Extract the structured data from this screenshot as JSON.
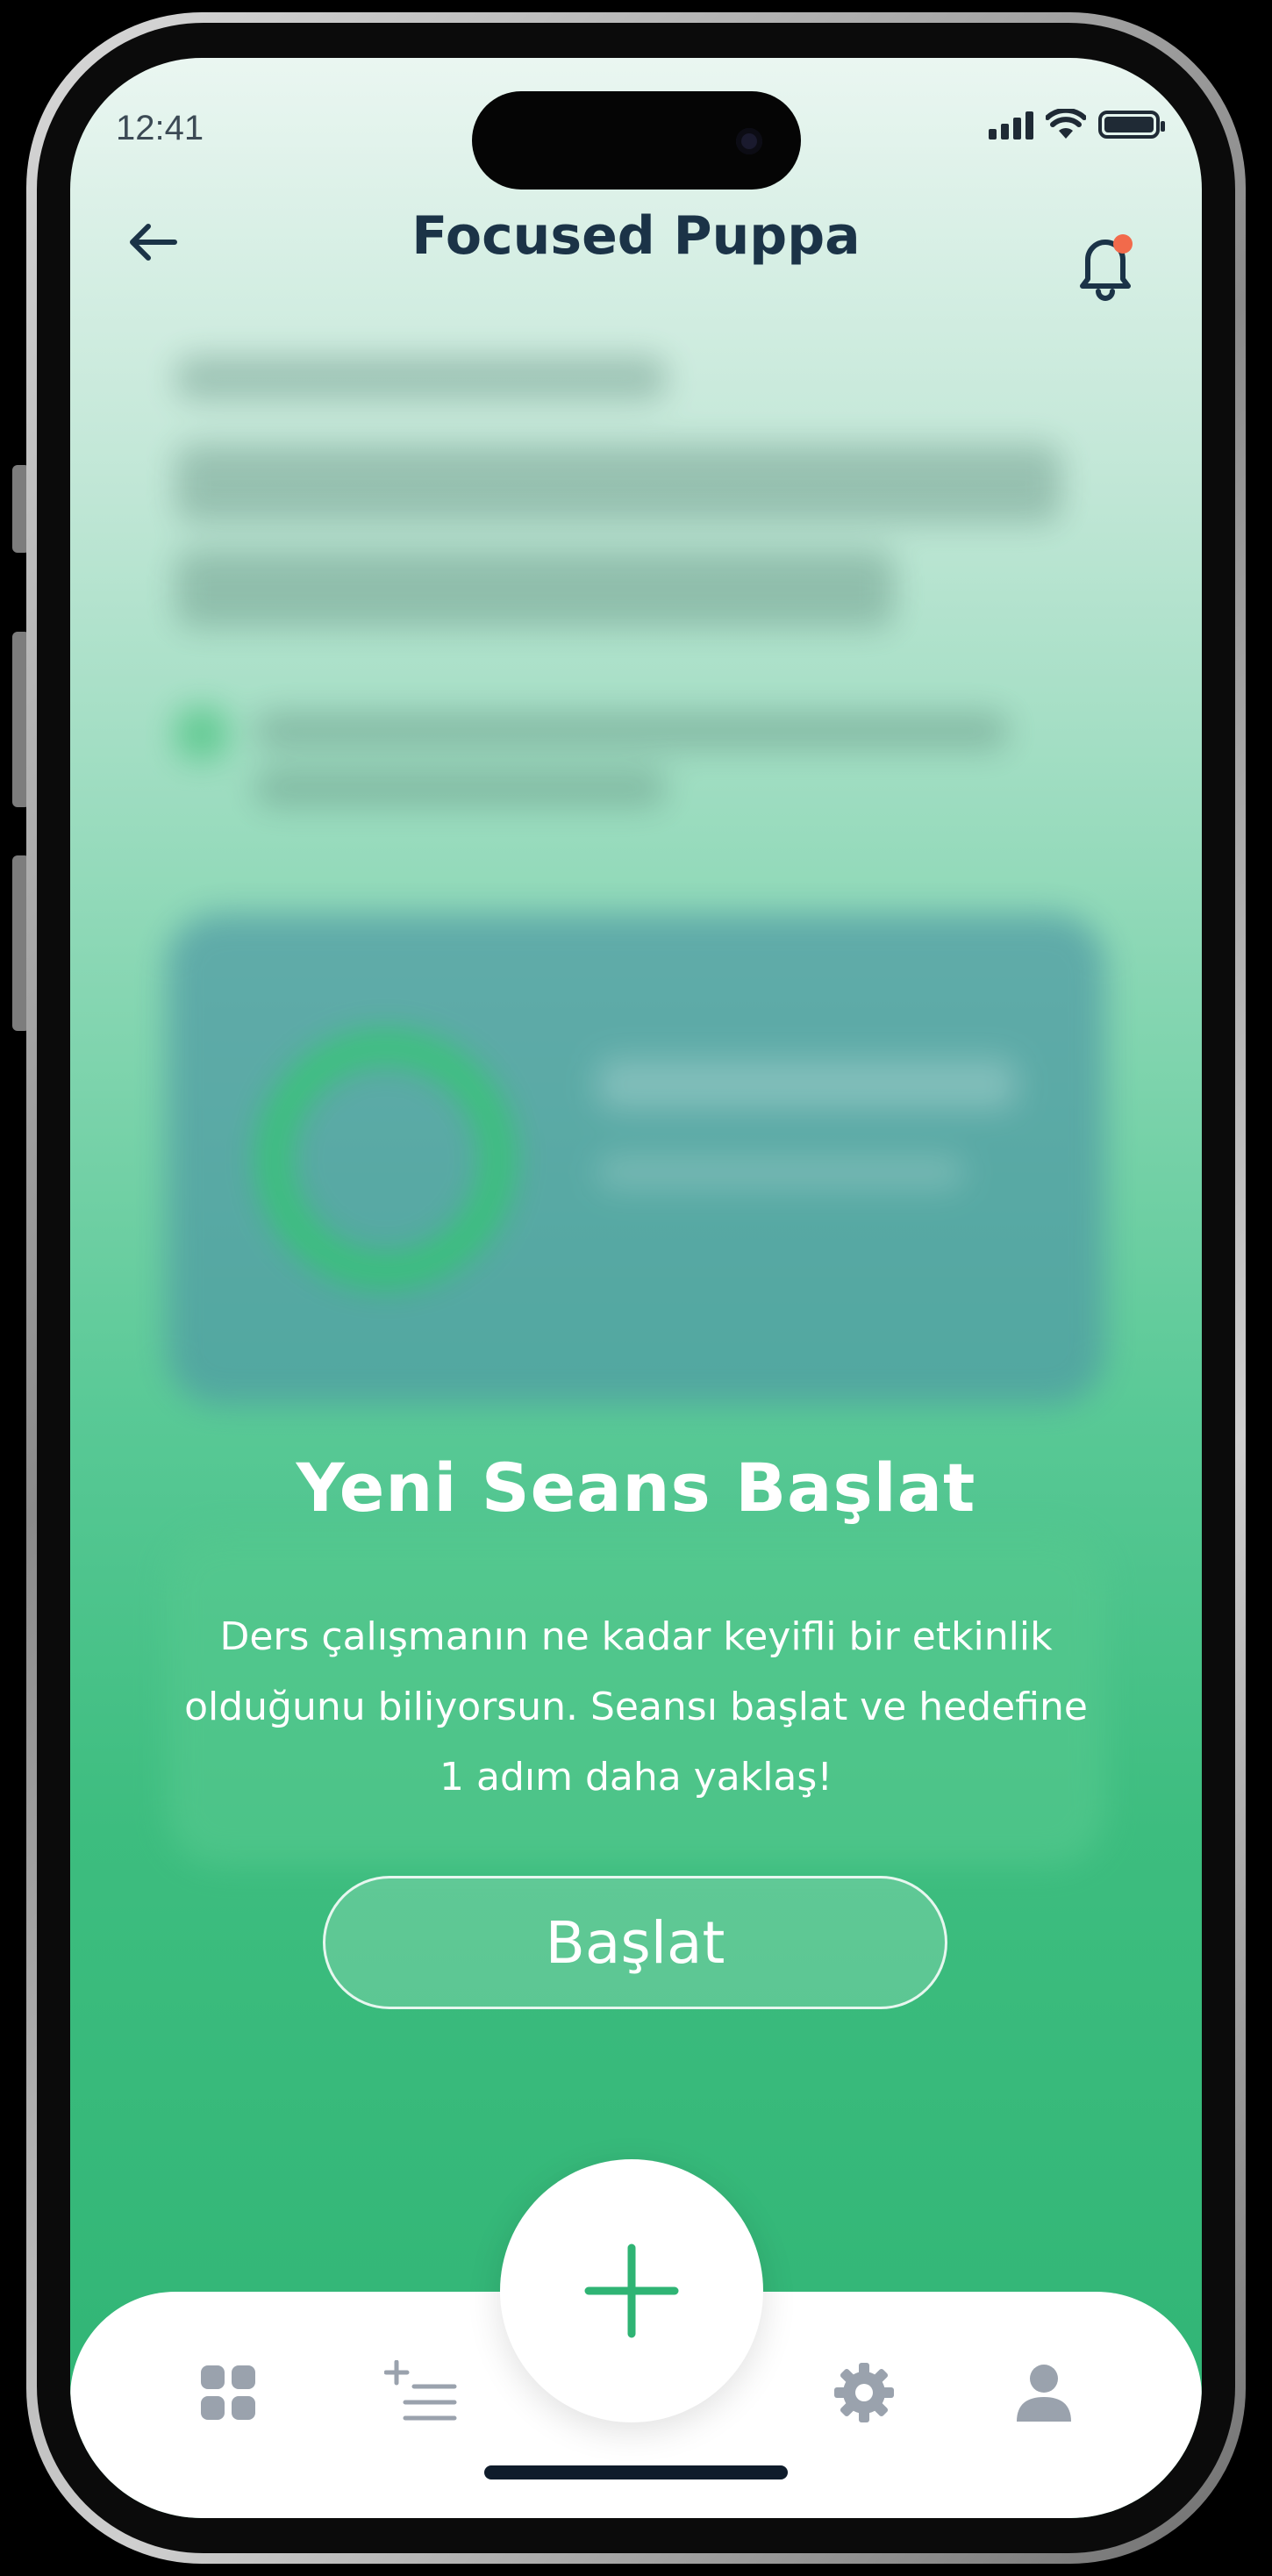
{
  "status_bar": {
    "time": "12:41"
  },
  "header": {
    "title": "Focused Puppa"
  },
  "overlay": {
    "title": "Yeni Seans Başlat",
    "description_lines": [
      "Ders çalışmanın ne kadar keyifli bir etkinlik",
      "olduğunu biliyorsun. Seansı başlat ve hedefine",
      "1 adım daha yaklaş!"
    ],
    "start_label": "Başlat"
  },
  "tabbar": {
    "items": [
      {
        "icon": "grid-icon"
      },
      {
        "icon": "add-list-icon"
      },
      {
        "icon": "plus-icon"
      },
      {
        "icon": "gear-icon"
      },
      {
        "icon": "user-icon"
      }
    ]
  },
  "colors": {
    "accent_green": "#2fb474",
    "title_navy": "#1b3347",
    "notification_dot": "#f26a4b"
  }
}
